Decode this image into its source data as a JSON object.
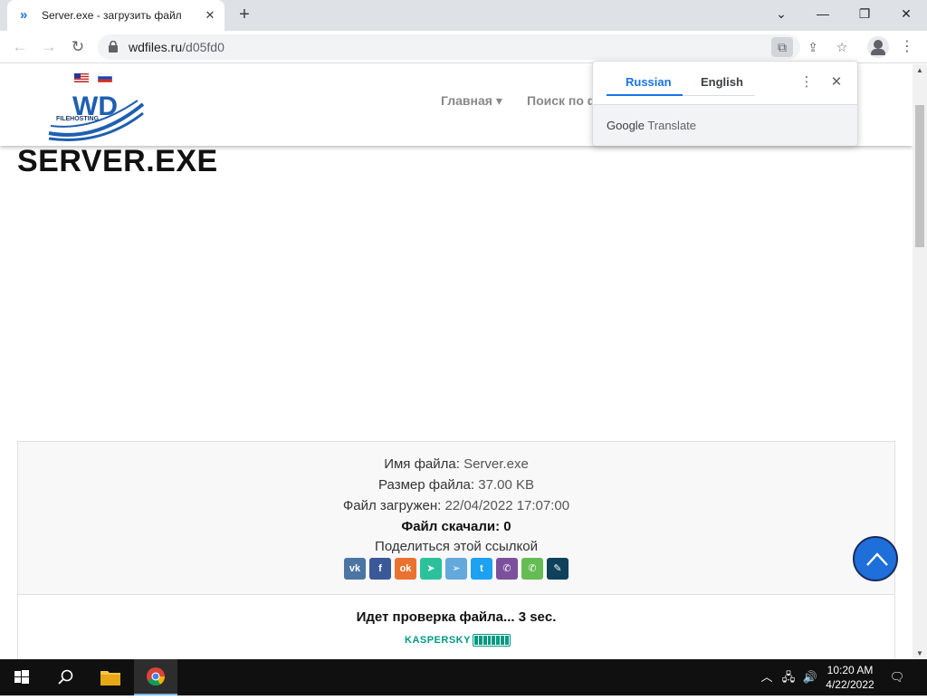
{
  "browser": {
    "tab_title": "Server.exe - загрузить файл",
    "tab_close": "✕",
    "new_tab": "+",
    "url_host": "wdfiles.ru",
    "url_path": "/d05fd0",
    "window_controls": {
      "minimize": "—",
      "maximize": "❐",
      "close": "✕",
      "collapse": "⌄"
    }
  },
  "translate_popup": {
    "tab_source": "Russian",
    "tab_target": "English",
    "more_icon": "⋮",
    "close_icon": "✕",
    "brand_google": "Google",
    "brand_translate": "Translate"
  },
  "site": {
    "logo_text": "WD",
    "logo_subtext": "FILEHOSTING",
    "nav": [
      {
        "label": "Главная ▾"
      },
      {
        "label": "Поиск по ф"
      }
    ]
  },
  "file": {
    "title": "SERVER.EXE",
    "name_label": "Имя файла:",
    "name_value": "Server.exe",
    "size_label": "Размер файла:",
    "size_value": "37.00 KB",
    "uploaded_label": "Файл загружен:",
    "uploaded_value": "22/04/2022 17:07:00",
    "downloads_line": "Файл скачали: 0",
    "share_label": "Поделиться этой ссылкой",
    "share_buttons": [
      {
        "name": "vk",
        "glyph": "vk",
        "color": "#4c75a3"
      },
      {
        "name": "facebook",
        "glyph": "f",
        "color": "#3b5998"
      },
      {
        "name": "odnoklassniki",
        "glyph": "ok",
        "color": "#eb722e"
      },
      {
        "name": "moimir",
        "glyph": "➤",
        "color": "#2bc29b"
      },
      {
        "name": "telegram",
        "glyph": "➢",
        "color": "#64a9dc"
      },
      {
        "name": "twitter",
        "glyph": "t",
        "color": "#1da1f2"
      },
      {
        "name": "viber",
        "glyph": "✆",
        "color": "#7b519d"
      },
      {
        "name": "whatsapp",
        "glyph": "✆",
        "color": "#65bc54"
      },
      {
        "name": "livejournal",
        "glyph": "✎",
        "color": "#0d425a"
      }
    ],
    "checking_text": "Идет проверка файла... 3 sec.",
    "antivirus_brand": "KASPERSKY"
  },
  "taskbar": {
    "clock_time": "10:20 AM",
    "clock_date": "4/22/2022"
  },
  "colors": {
    "accent": "#1a73e8",
    "logo_blue": "#1f5fb0",
    "kaspersky_green": "#009982",
    "scroll_top_blue": "#1e6fd9"
  }
}
